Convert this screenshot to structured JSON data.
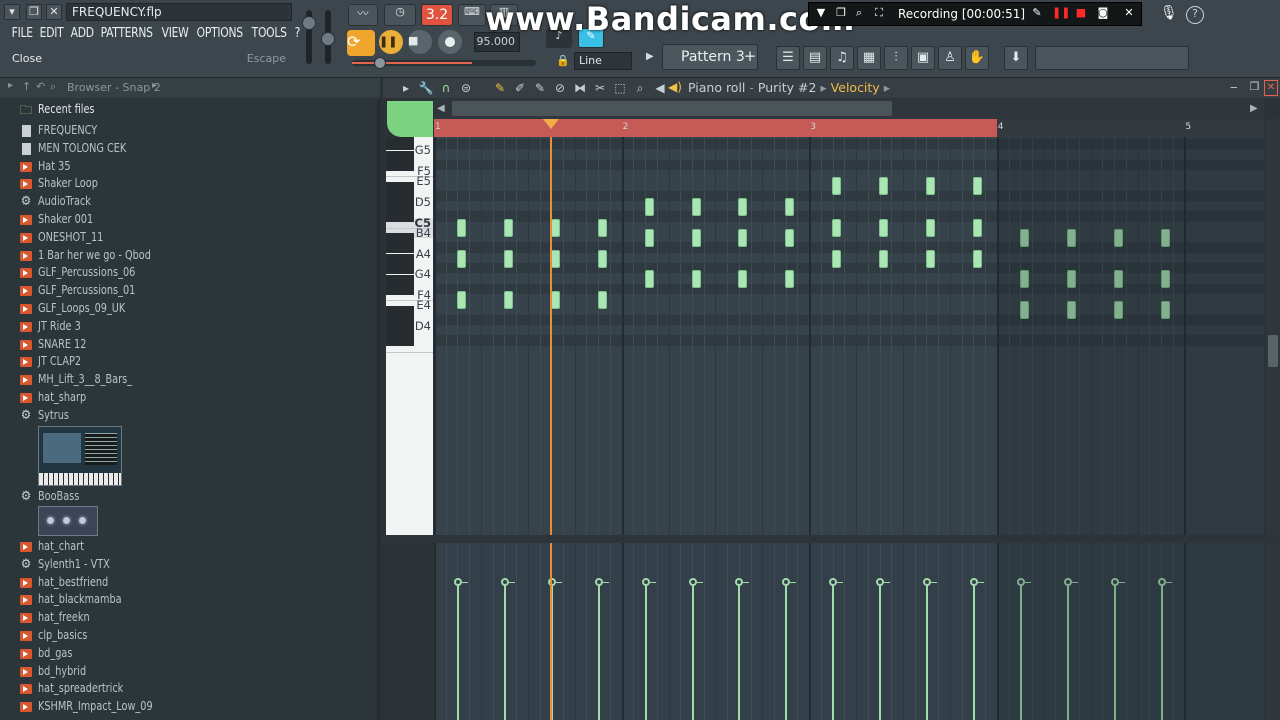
{
  "window": {
    "title": "FREQUENCY.flp",
    "menu": [
      "FILE",
      "EDIT",
      "ADD",
      "PATTERNS",
      "VIEW",
      "OPTIONS",
      "TOOLS",
      "?"
    ],
    "hint_label": "Close",
    "hint_key": "Escape"
  },
  "transport": {
    "mode_indicator": "3.2",
    "tempo": "95.000",
    "snap_mode": "Line",
    "pattern": "Pattern 3",
    "pattern_add": "+"
  },
  "recording": {
    "watermark": "www.Bandicam.com",
    "status": "Recording [00:00:51]"
  },
  "browser": {
    "title": "Browser - Snap 2",
    "recent_label": "Recent files",
    "items": [
      {
        "label": "FREQUENCY",
        "icon": "file-icon"
      },
      {
        "label": "MEN TOLONG CEK",
        "icon": "file-icon"
      },
      {
        "label": "Hat 35",
        "icon": "audio-clip-icon"
      },
      {
        "label": "Shaker Loop",
        "icon": "audio-clip-icon"
      },
      {
        "label": "AudioTrack",
        "icon": "plugin-gear-icon"
      },
      {
        "label": "Shaker 001",
        "icon": "audio-clip-icon"
      },
      {
        "label": "ONESHOT_11",
        "icon": "audio-clip-icon"
      },
      {
        "label": "1 Bar her we go - Qbod",
        "icon": "audio-clip-icon"
      },
      {
        "label": "GLF_Percussions_06",
        "icon": "audio-clip-icon"
      },
      {
        "label": "GLF_Percussions_01",
        "icon": "audio-clip-icon"
      },
      {
        "label": "GLF_Loops_09_UK",
        "icon": "audio-clip-icon"
      },
      {
        "label": "JT Ride 3",
        "icon": "audio-clip-icon"
      },
      {
        "label": "SNARE 12",
        "icon": "audio-clip-icon"
      },
      {
        "label": "JT CLAP2",
        "icon": "audio-clip-icon"
      },
      {
        "label": "MH_Lift_3__8_Bars_",
        "icon": "audio-clip-icon"
      },
      {
        "label": "hat_sharp",
        "icon": "audio-clip-icon"
      },
      {
        "label": "Sytrus",
        "icon": "plugin-gear-icon"
      }
    ],
    "items2": [
      {
        "label": "BooBass",
        "icon": "plugin-gear-icon"
      }
    ],
    "items3": [
      {
        "label": "hat_chart",
        "icon": "audio-clip-icon"
      },
      {
        "label": "Sylenth1 - VTX",
        "icon": "plugin-gear-icon"
      },
      {
        "label": "hat_bestfriend",
        "icon": "audio-clip-icon"
      },
      {
        "label": "hat_blackmamba",
        "icon": "audio-clip-icon"
      },
      {
        "label": "hat_freekn",
        "icon": "audio-clip-icon"
      },
      {
        "label": "clp_basics",
        "icon": "audio-clip-icon"
      },
      {
        "label": "bd_gas",
        "icon": "audio-clip-icon"
      },
      {
        "label": "bd_hybrid",
        "icon": "audio-clip-icon"
      },
      {
        "label": "hat_spreadertrick",
        "icon": "audio-clip-icon"
      },
      {
        "label": "KSHMR_Impact_Low_09",
        "icon": "audio-clip-icon"
      }
    ]
  },
  "piano_roll": {
    "title_prefix": "Piano roll",
    "channel": "Purity #2",
    "target": "Velocity",
    "bars": [
      "1",
      "2",
      "3",
      "4",
      "5"
    ],
    "key_labels": [
      "G5",
      "F5",
      "E5",
      "D5",
      "C5",
      "B4",
      "A4",
      "G4",
      "F4",
      "E4",
      "D4"
    ],
    "notes": [
      {
        "pitch": "C5",
        "start": 1.0
      },
      {
        "pitch": "C5",
        "start": 1.25
      },
      {
        "pitch": "C5",
        "start": 1.5
      },
      {
        "pitch": "C5",
        "start": 1.75
      },
      {
        "pitch": "A4",
        "start": 1.0
      },
      {
        "pitch": "A4",
        "start": 1.25
      },
      {
        "pitch": "A4",
        "start": 1.5
      },
      {
        "pitch": "A4",
        "start": 1.75
      },
      {
        "pitch": "F4",
        "start": 1.0
      },
      {
        "pitch": "F4",
        "start": 1.25
      },
      {
        "pitch": "F4",
        "start": 1.5
      },
      {
        "pitch": "F4",
        "start": 1.75
      },
      {
        "pitch": "D5",
        "start": 2.0
      },
      {
        "pitch": "D5",
        "start": 2.25
      },
      {
        "pitch": "D5",
        "start": 2.5
      },
      {
        "pitch": "D5",
        "start": 2.75
      },
      {
        "pitch": "B4",
        "start": 2.0
      },
      {
        "pitch": "B4",
        "start": 2.25
      },
      {
        "pitch": "B4",
        "start": 2.5
      },
      {
        "pitch": "B4",
        "start": 2.75
      },
      {
        "pitch": "G4",
        "start": 2.0
      },
      {
        "pitch": "G4",
        "start": 2.25
      },
      {
        "pitch": "G4",
        "start": 2.5
      },
      {
        "pitch": "G4",
        "start": 2.75
      },
      {
        "pitch": "E5",
        "start": 3.0
      },
      {
        "pitch": "E5",
        "start": 3.25
      },
      {
        "pitch": "E5",
        "start": 3.5
      },
      {
        "pitch": "E5",
        "start": 3.75
      },
      {
        "pitch": "C5",
        "start": 3.0
      },
      {
        "pitch": "C5",
        "start": 3.25
      },
      {
        "pitch": "C5",
        "start": 3.5
      },
      {
        "pitch": "C5",
        "start": 3.75
      },
      {
        "pitch": "A4",
        "start": 3.0
      },
      {
        "pitch": "A4",
        "start": 3.25
      },
      {
        "pitch": "A4",
        "start": 3.5
      },
      {
        "pitch": "A4",
        "start": 3.75
      },
      {
        "pitch": "B4",
        "start": 4.0
      },
      {
        "pitch": "B4",
        "start": 4.25
      },
      {
        "pitch": "B4",
        "start": 4.5
      },
      {
        "pitch": "B4",
        "start": 4.75
      },
      {
        "pitch": "G4",
        "start": 4.0
      },
      {
        "pitch": "G4",
        "start": 4.25
      },
      {
        "pitch": "G4",
        "start": 4.5
      },
      {
        "pitch": "G4",
        "start": 4.75
      },
      {
        "pitch": "E4",
        "start": 4.0
      },
      {
        "pitch": "E4",
        "start": 4.25
      },
      {
        "pitch": "E4",
        "start": 4.5
      },
      {
        "pitch": "E4",
        "start": 4.75
      }
    ],
    "playhead_position": 1.625,
    "loop_end_bar": 4.0,
    "velocity_level": 0.78
  },
  "colors": {
    "note": "#a9e6b4",
    "loop_region": "#c55a57",
    "playhead": "#e88d3b",
    "accent_orange": "#f0a52c",
    "tempo_display": "#e0533f"
  }
}
